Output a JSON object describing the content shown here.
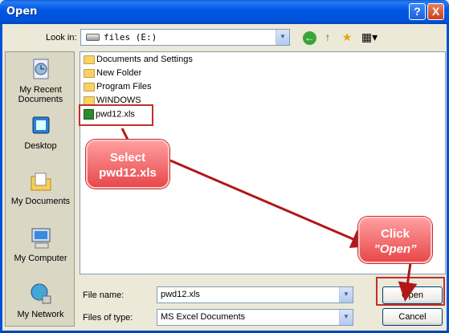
{
  "window": {
    "title": "Open",
    "help_glyph": "?",
    "close_glyph": "X"
  },
  "toolbar": {
    "look_in_label": "Look in:",
    "look_in_value": "files (E:)",
    "back_glyph": "←",
    "up_glyph": "↑",
    "new_folder_glyph": "★",
    "views_glyph": "▦▾"
  },
  "places": [
    {
      "label_line1": "My Recent",
      "label_line2": "Documents",
      "icon": "recent-documents-icon"
    },
    {
      "label_line1": "Desktop",
      "label_line2": "",
      "icon": "desktop-icon"
    },
    {
      "label_line1": "My Documents",
      "label_line2": "",
      "icon": "my-documents-icon"
    },
    {
      "label_line1": "My Computer",
      "label_line2": "",
      "icon": "my-computer-icon"
    },
    {
      "label_line1": "My Network",
      "label_line2": "",
      "icon": "my-network-icon"
    }
  ],
  "files": [
    {
      "name": "Documents and Settings",
      "type": "folder"
    },
    {
      "name": "New Folder",
      "type": "folder"
    },
    {
      "name": "Program Files",
      "type": "folder"
    },
    {
      "name": "WINDOWS",
      "type": "folder"
    },
    {
      "name": "pwd12.xls",
      "type": "excel"
    }
  ],
  "form": {
    "file_name_label": "File name:",
    "file_name_value": "pwd12.xls",
    "file_type_label": "Files of type:",
    "file_type_value": "MS Excel Documents",
    "open_label": "Open",
    "cancel_label": "Cancel",
    "dropdown_glyph": "▼"
  },
  "annotations": {
    "select_line1": "Select",
    "select_line2": "pwd12.xls",
    "click_line1": "Click",
    "click_line2": "”Open”"
  },
  "colors": {
    "title_blue": "#0053d9",
    "callout_red": "#e8484a",
    "highlight_red": "#c03030"
  }
}
